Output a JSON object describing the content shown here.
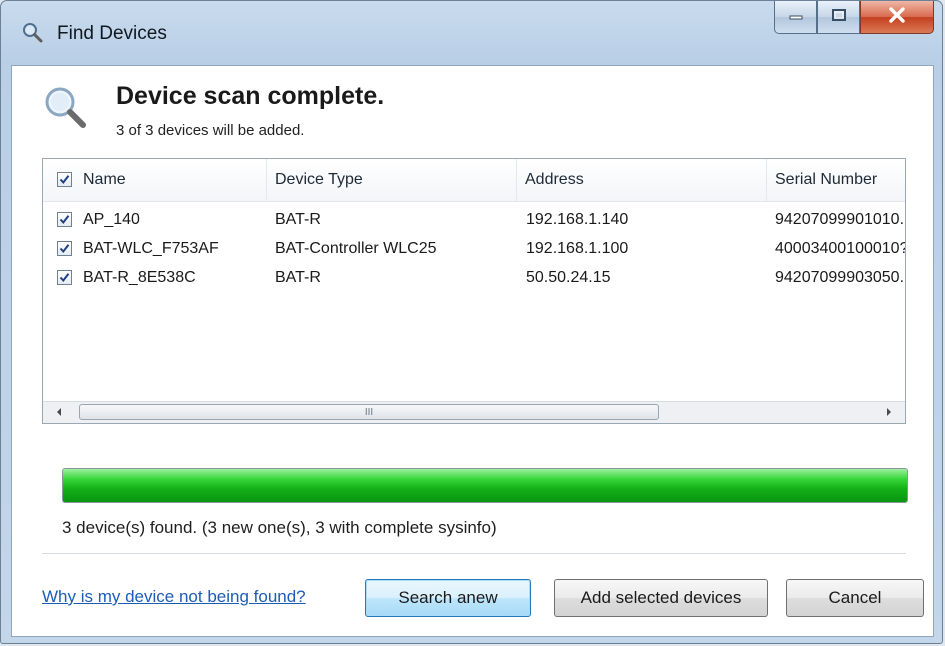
{
  "window": {
    "title": "Find Devices"
  },
  "header": {
    "title": "Device scan complete.",
    "subtitle": "3 of 3 devices will be added."
  },
  "table": {
    "header_checked": true,
    "columns": [
      "Name",
      "Device Type",
      "Address",
      "Serial Number"
    ],
    "rows": [
      {
        "checked": true,
        "name": "AP_140",
        "device_type": "BAT-R",
        "address": "192.168.1.140",
        "serial": "94207099901010."
      },
      {
        "checked": true,
        "name": "BAT-WLC_F753AF",
        "device_type": "BAT-Controller WLC25",
        "address": "192.168.1.100",
        "serial": "40003400100010?"
      },
      {
        "checked": true,
        "name": "BAT-R_8E538C",
        "device_type": "BAT-R",
        "address": "50.50.24.15",
        "serial": "94207099903050."
      }
    ],
    "scrollbar_grip": "III"
  },
  "progress": {
    "percent": 100,
    "color": "#21c424"
  },
  "status": "3 device(s) found. (3 new one(s), 3 with complete sysinfo)",
  "footer": {
    "help_link": "Why is my device not being found?",
    "search_button": "Search anew",
    "add_button": "Add selected devices",
    "cancel_button": "Cancel"
  },
  "icons": {
    "title": "magnifier-icon",
    "header": "magnifier-icon",
    "minimize": "minimize-icon",
    "maximize": "maximize-icon",
    "close": "close-icon"
  }
}
